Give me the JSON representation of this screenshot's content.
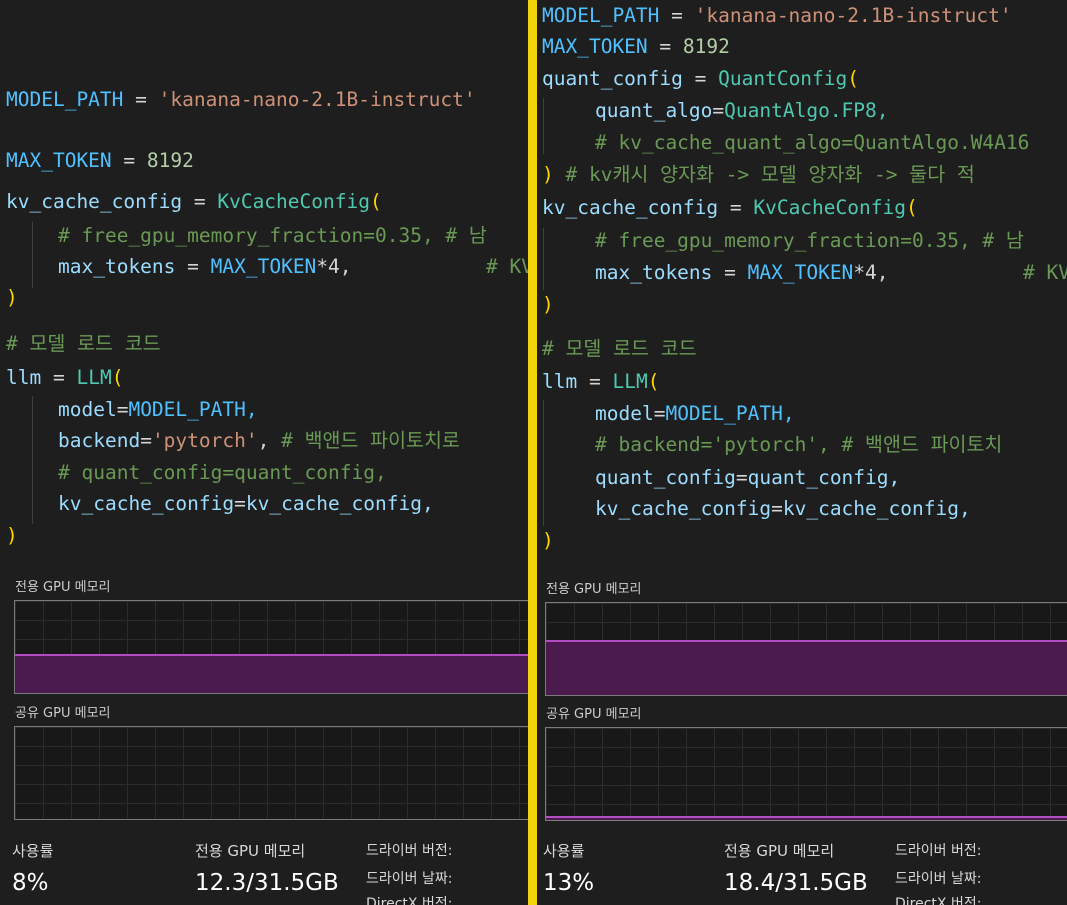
{
  "left": {
    "code": {
      "model_path_name": "MODEL_PATH",
      "model_path_value": "'kanana-nano-2.1B-instruct'",
      "max_token_name": "MAX_TOKEN",
      "max_token_value": "8192",
      "kv_var": "kv_cache_config",
      "kv_class": "KvCacheConfig",
      "kv_comment": "# free_gpu_memory_fraction=0.35, # 남",
      "max_tokens_param": "max_tokens",
      "max_token_ref": "MAX_TOKEN",
      "times_four": "*4,",
      "kv_comment2": "# KV",
      "section_comment": "# 모델 로드 코드",
      "llm_var": "llm",
      "llm_class": "LLM",
      "model_param": "model",
      "model_value": "MODEL_PATH,",
      "backend_param": "backend",
      "backend_value": "'pytorch'",
      "backend_comment": "# 백앤드 파이토치로",
      "quant_line": "# quant_config=quant_config,",
      "kv_line_param": "kv_cache_config",
      "kv_line_value": "kv_cache_config,"
    },
    "monitor": {
      "dedicated_label": "전용 GPU 메모리",
      "shared_label": "공유 GPU 메모리",
      "dedicated_fill_fraction": 0.4,
      "shared_fill_fraction": 0.0,
      "usage_label": "사용률",
      "usage_value": "8%",
      "dedicated_mem_label": "전용 GPU 메모리",
      "dedicated_mem_value": "12.3/31.5GB",
      "driver_version": "드라이버 버전:",
      "driver_date": "드라이버 날짜:",
      "directx": "DirectX 버전:"
    }
  },
  "right": {
    "code": {
      "model_path_name": "MODEL_PATH",
      "model_path_value": "'kanana-nano-2.1B-instruct'",
      "max_token_name": "MAX_TOKEN",
      "max_token_value": "8192",
      "quant_var": "quant_config",
      "quant_class": "QuantConfig",
      "quant_algo_param": "quant_algo",
      "quant_algo_value": "QuantAlgo.FP8,",
      "kv_quant_comment": "# kv_cache_quant_algo=QuantAlgo.W4A16",
      "close_comment": "# kv캐시 양자화 -> 모델 양자화 -> 둘다 적",
      "kv_var": "kv_cache_config",
      "kv_class": "KvCacheConfig",
      "kv_comment": "# free_gpu_memory_fraction=0.35, # 남",
      "max_tokens_param": "max_tokens",
      "max_token_ref": "MAX_TOKEN",
      "times_four": "*4,",
      "kv_comment2": "# KV",
      "section_comment": "# 모델 로드 코드",
      "llm_var": "llm",
      "llm_class": "LLM",
      "model_param": "model",
      "model_value": "MODEL_PATH,",
      "backend_comment": "# backend='pytorch', # 백앤드 파이토치",
      "quant_line_param": "quant_config",
      "quant_line_value": "quant_config,",
      "kv_line_param": "kv_cache_config",
      "kv_line_value": "kv_cache_config,"
    },
    "monitor": {
      "dedicated_label": "전용 GPU 메모리",
      "shared_label": "공유 GPU 메모리",
      "dedicated_fill_fraction": 0.58,
      "shared_fill_fraction": 0.02,
      "usage_label": "사용률",
      "usage_value": "13%",
      "dedicated_mem_label": "전용 GPU 메모리",
      "dedicated_mem_value": "18.4/31.5GB",
      "driver_version": "드라이버 버전:",
      "driver_date": "드라이버 날짜:",
      "directx": "DirectX 버전:"
    }
  },
  "colors": {
    "divider": "#f2d40c",
    "memory_fill": "#4b1a4e",
    "memory_line": "#b04ec0"
  }
}
